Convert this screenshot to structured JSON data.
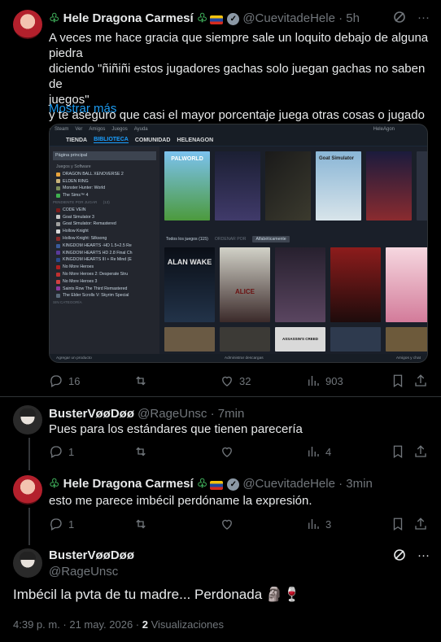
{
  "post1": {
    "name": "Hele Dragona Carmesí",
    "handle": "@CuevitadeHele",
    "time": "5h",
    "text": "A veces me hace gracia que siempre sale un loquito debajo de alguna piedra\ndiciendo \"ñiñiñi estos jugadores gachas solo juegan gachas no saben de\njuegos\"\ny te aseguro que casi el mayor porcentaje juega otras cosas o jugado a lo\nlargo de su vida, que obviamente no serán todos pero",
    "show_more": "Mostrar más",
    "replies": "16",
    "likes": "32",
    "views": "903"
  },
  "steam": {
    "top_menu": [
      "Steam",
      "Ver",
      "Amigos",
      "Juegos",
      "Ayuda"
    ],
    "user": "HeleAgon",
    "nav": [
      "TIENDA",
      "BIBLIOTECA",
      "COMUNIDAD",
      "HELENAGON"
    ],
    "home": "Página principal",
    "filter": "Juegos y Software",
    "recent": [
      "DRAGON BALL XENOVERSE 2",
      "ELDEN RING",
      "Monster Hunter: World",
      "The Sims™ 4"
    ],
    "pending_label": "PENDIENTE POR JUGAR",
    "pending_count": "(13)",
    "pending": [
      "CODE VEIN",
      "Goat Simulator 3",
      "Goat Simulator: Remastered",
      "Hollow Knight",
      "Hollow Knight: Silksong",
      "KINGDOM HEARTS -HD 1.5+2.5 Re",
      "KINGDOM HEARTS HD 2.8 Final Ch",
      "KINGDOM HEARTS III + Re Mind (E",
      "No More Heroes",
      "No More Heroes 2: Desperate Stru",
      "No More Heroes 3",
      "Saints Row The Third Remastered",
      "The Elder Scrolls V: Skyrim Special"
    ],
    "category_label": "SIN CATEGORÍA",
    "add_game": "Agregar un producto",
    "downloads": "Administrar descargas",
    "friends": "Amigos y chat",
    "all_games": "Todos los juegos",
    "all_games_count": "(115)",
    "order_by": "ORDENAR POR",
    "sort": "Alfabéticamente",
    "game_titles": [
      "PALWORLD",
      "Goat Simulator",
      "ALAN WAKE",
      "ALICE",
      "ASSASSIN'S CREED"
    ]
  },
  "reply1": {
    "name": "BusterVøøDøø",
    "handle": "@RageUnsc",
    "time": "7min",
    "text": "Pues para los estándares que tienen parecería",
    "replies": "1",
    "views": "4"
  },
  "reply2": {
    "name": "Hele Dragona Carmesí",
    "handle": "@CuevitadeHele",
    "time": "3min",
    "text": "esto me parece imbécil perdóname la expresión.",
    "replies": "1",
    "views": "3"
  },
  "main": {
    "name": "BusterVøøDøø",
    "handle": "@RageUnsc",
    "text": "Imbécil la pvta de tu madre... Perdonada 🗿🍷",
    "time": "4:39 p. m. · 21 may. 2026 · ",
    "views": "2",
    "views_label": " Visualizaciones"
  },
  "colors": {
    "accent": "#1d9bf0",
    "muted": "#71767b",
    "bg": "#000000",
    "steam_blue": "#1a9fff"
  }
}
